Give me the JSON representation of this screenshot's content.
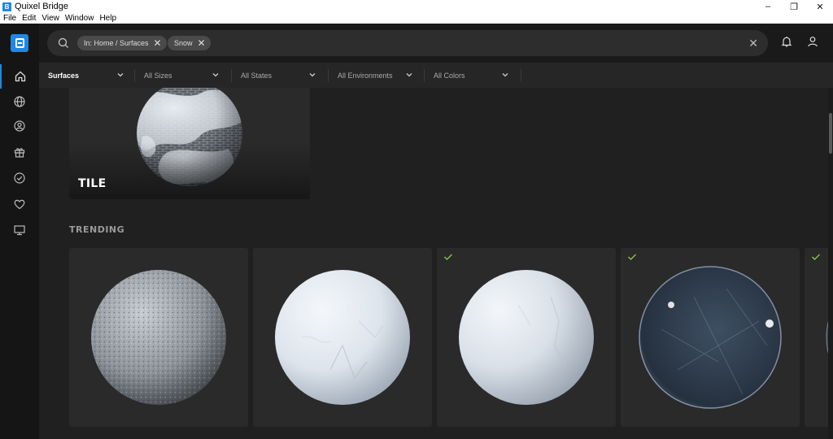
{
  "window": {
    "title": "Quixel Bridge",
    "app_icon_glyph": "B",
    "minimize": "–",
    "restore": "❐",
    "close": "✕"
  },
  "menu": [
    "File",
    "Edit",
    "View",
    "Window",
    "Help"
  ],
  "sidebar": {
    "items": [
      {
        "name": "home-icon",
        "active": true
      },
      {
        "name": "globe-icon",
        "active": false
      },
      {
        "name": "user-circle-icon",
        "active": false
      },
      {
        "name": "gift-icon",
        "active": false
      },
      {
        "name": "check-circle-icon",
        "active": false
      },
      {
        "name": "heart-icon",
        "active": false
      },
      {
        "name": "monitor-icon",
        "active": false
      }
    ]
  },
  "search": {
    "chips": [
      {
        "label": "In: Home / Surfaces",
        "remove": "✕"
      },
      {
        "label": "Snow",
        "remove": "✕"
      }
    ],
    "clear": "✕"
  },
  "filters": [
    {
      "label": "Surfaces",
      "primary": true
    },
    {
      "label": "All Sizes",
      "primary": false
    },
    {
      "label": "All States",
      "primary": false
    },
    {
      "label": "All Environments",
      "primary": false
    },
    {
      "label": "All Colors",
      "primary": false
    }
  ],
  "content": {
    "top_card_label": "TILE",
    "section_title": "TRENDING",
    "cards": [
      {
        "material": "rough snow",
        "downloaded": false
      },
      {
        "material": "packed snow",
        "downloaded": false
      },
      {
        "material": "snow",
        "downloaded": true
      },
      {
        "material": "ice",
        "downloaded": true
      },
      {
        "material": "partial",
        "downloaded": true
      }
    ]
  },
  "colors": {
    "accent": "#1e88e5",
    "check": "#8bc34a",
    "background": "#202020",
    "card": "#2a2a2a"
  }
}
